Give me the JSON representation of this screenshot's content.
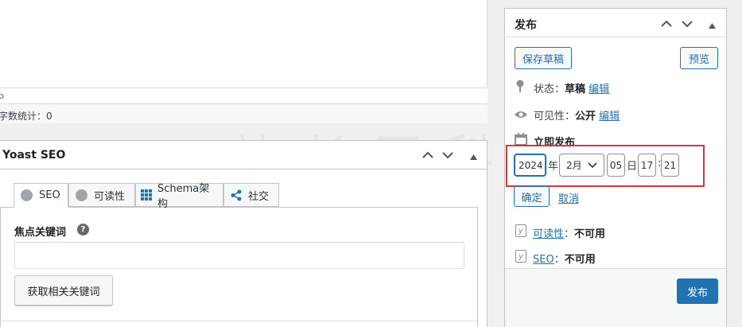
{
  "editor": {
    "path_text": "p",
    "word_count_label": "字数统计：",
    "word_count_value": "0"
  },
  "yoast": {
    "title": "Yoast SEO",
    "tabs": [
      {
        "label": "SEO"
      },
      {
        "label": "可读性"
      },
      {
        "label": "Schema架构"
      },
      {
        "label": "社交"
      }
    ],
    "focus_keyword_label": "焦点关键词",
    "focus_keyword_value": "",
    "related_button": "获取相关关键词"
  },
  "publish": {
    "title": "发布",
    "save_draft": "保存草稿",
    "preview": "预览",
    "status_label": "状态：",
    "status_value": "草稿",
    "status_edit": "编辑",
    "visibility_label": "可见性：",
    "visibility_value": "公开",
    "visibility_edit": "编辑",
    "schedule_label": "立即发布",
    "date": {
      "year": "2024",
      "year_suffix": "年",
      "month": "2月",
      "day": "05",
      "day_suffix": "日",
      "hour": "17",
      "time_sep": ":",
      "minute": "21"
    },
    "ok": "确定",
    "cancel": "取消",
    "readability_link": "可读性",
    "readability_value": "不可用",
    "seo_link": "SEO",
    "seo_value": "不可用",
    "colon": "：",
    "publish_button": "发布"
  },
  "colors": {
    "accent": "#2271b1",
    "highlight_border": "#d63638",
    "background": "#f0f0f1"
  },
  "watermark": "站长百科"
}
